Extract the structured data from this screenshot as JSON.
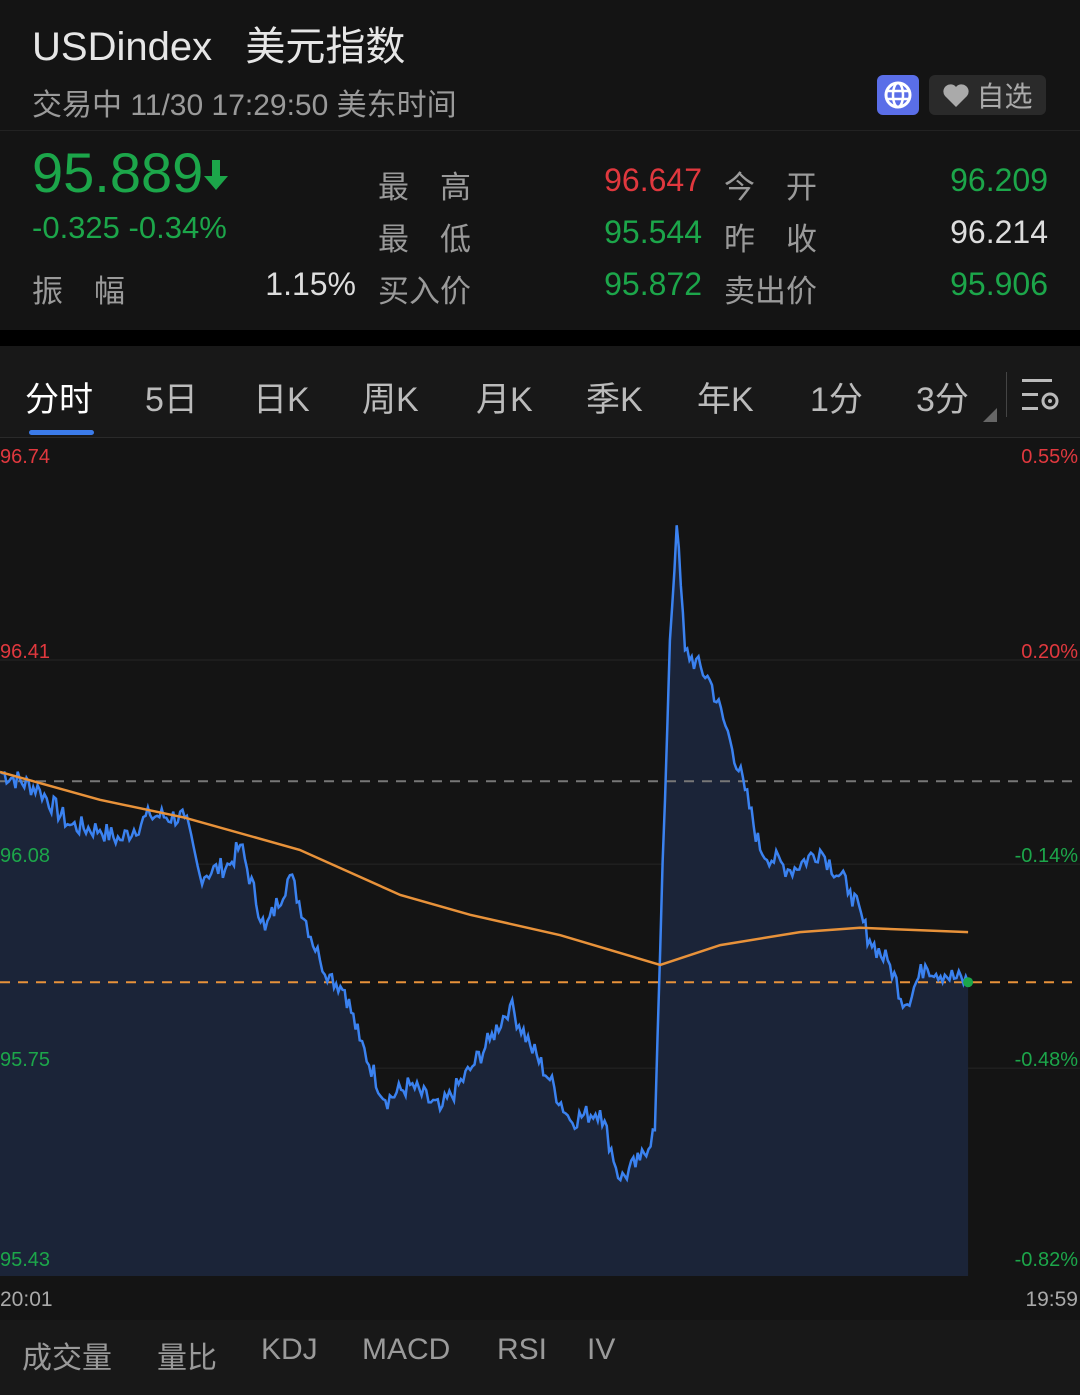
{
  "header": {
    "symbol": "USDindex",
    "name": "美元指数",
    "status": "交易中 11/30 17:29:50 美东时间",
    "watchlist_label": "自选"
  },
  "quote": {
    "price": "95.889",
    "change": "-0.325",
    "change_pct": "-0.34%",
    "high_label": "最　高",
    "high": "96.647",
    "open_label": "今　开",
    "open": "96.209",
    "low_label": "最　低",
    "low": "95.544",
    "prev_close_label": "昨　收",
    "prev_close": "96.214",
    "amplitude_label": "振　幅",
    "amplitude": "1.15%",
    "bid_label": "买入价",
    "bid": "95.872",
    "ask_label": "卖出价",
    "ask": "95.906"
  },
  "tabs": [
    "分时",
    "5日",
    "日K",
    "周K",
    "月K",
    "季K",
    "年K",
    "1分",
    "3分"
  ],
  "indicators": [
    "成交量",
    "量比",
    "KDJ",
    "MACD",
    "RSI",
    "IV"
  ],
  "colors": {
    "up": "#e0383e",
    "down": "#1ca64a",
    "line": "#3b82f0",
    "avg": "#e8923a",
    "accent": "#3b7bea"
  },
  "chart_data": {
    "type": "line",
    "y_ticks_left": [
      "96.74",
      "96.41",
      "96.08",
      "95.75",
      "95.43"
    ],
    "y_ticks_right": [
      "0.55%",
      "0.20%",
      "-0.14%",
      "-0.48%",
      "-0.82%"
    ],
    "ylim": [
      95.43,
      96.74
    ],
    "x_start_label": "20:01",
    "x_end_label": "19:59",
    "total_minutes": 1438,
    "prev_close": 96.214,
    "last_price": 95.889,
    "series": [
      {
        "name": "price",
        "points": [
          [
            0,
            96.229
          ],
          [
            53,
            96.2
          ],
          [
            93,
            96.143
          ],
          [
            133,
            96.135
          ],
          [
            160,
            96.119
          ],
          [
            200,
            96.159
          ],
          [
            246,
            96.155
          ],
          [
            266,
            96.062
          ],
          [
            306,
            96.079
          ],
          [
            320,
            96.111
          ],
          [
            353,
            95.973
          ],
          [
            386,
            96.062
          ],
          [
            426,
            95.925
          ],
          [
            439,
            95.901
          ],
          [
            459,
            95.876
          ],
          [
            479,
            95.795
          ],
          [
            513,
            95.698
          ],
          [
            546,
            95.723
          ],
          [
            586,
            95.682
          ],
          [
            626,
            95.747
          ],
          [
            652,
            95.795
          ],
          [
            679,
            95.852
          ],
          [
            706,
            95.787
          ],
          [
            732,
            95.731
          ],
          [
            759,
            95.666
          ],
          [
            799,
            95.682
          ],
          [
            826,
            95.569
          ],
          [
            852,
            95.601
          ],
          [
            872,
            95.65
          ],
          [
            879,
            95.941
          ],
          [
            892,
            96.442
          ],
          [
            901,
            96.628
          ],
          [
            912,
            96.426
          ],
          [
            945,
            96.378
          ],
          [
            972,
            96.281
          ],
          [
            992,
            96.2
          ],
          [
            1012,
            96.103
          ],
          [
            1052,
            96.07
          ],
          [
            1092,
            96.103
          ],
          [
            1132,
            96.038
          ],
          [
            1158,
            95.957
          ],
          [
            1185,
            95.917
          ],
          [
            1205,
            95.852
          ],
          [
            1232,
            95.917
          ],
          [
            1258,
            95.901
          ],
          [
            1289,
            95.889
          ]
        ]
      },
      {
        "name": "average",
        "points": [
          [
            0,
            96.229
          ],
          [
            133,
            96.184
          ],
          [
            246,
            96.155
          ],
          [
            399,
            96.103
          ],
          [
            533,
            96.03
          ],
          [
            626,
            95.998
          ],
          [
            746,
            95.965
          ],
          [
            879,
            95.917
          ],
          [
            959,
            95.949
          ],
          [
            1065,
            95.97
          ],
          [
            1145,
            95.977
          ],
          [
            1289,
            95.97
          ]
        ]
      }
    ]
  }
}
